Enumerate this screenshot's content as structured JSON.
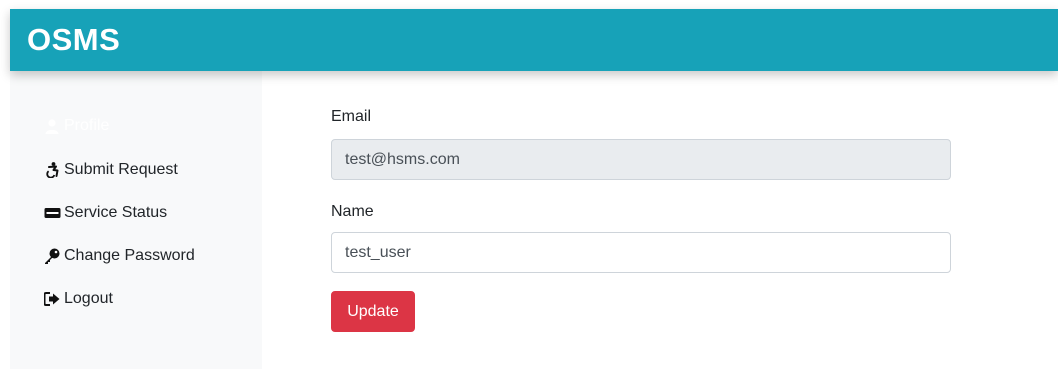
{
  "app": {
    "brand": "OSMS"
  },
  "sidebar": {
    "items": [
      {
        "label": "Profile",
        "icon": "user-icon",
        "active": true
      },
      {
        "label": "Submit Request",
        "icon": "accessibility-icon",
        "active": false
      },
      {
        "label": "Service Status",
        "icon": "card-icon",
        "active": false
      },
      {
        "label": "Change Password",
        "icon": "key-icon",
        "active": false
      },
      {
        "label": "Logout",
        "icon": "sign-out-icon",
        "active": false
      }
    ]
  },
  "form": {
    "email_label": "Email",
    "email_value": "test@hsms.com",
    "name_label": "Name",
    "name_value": "test_user",
    "update_label": "Update"
  },
  "colors": {
    "navbar": "#17a2b8",
    "sidebar": "#f8f9fa",
    "danger": "#dc3545",
    "readonly_bg": "#e9ecef"
  }
}
